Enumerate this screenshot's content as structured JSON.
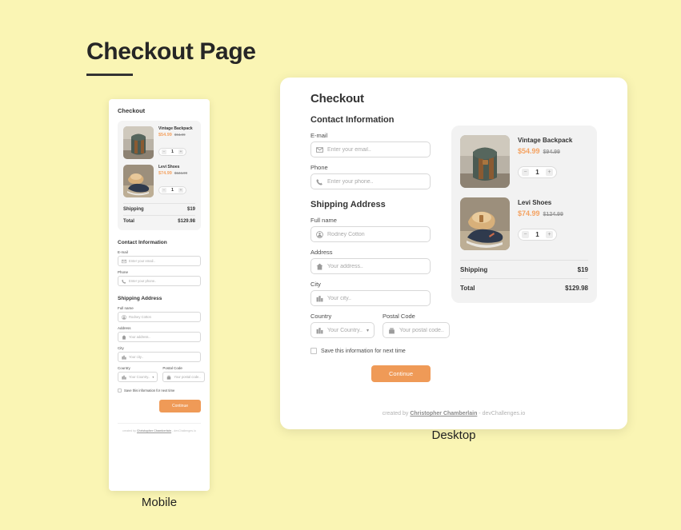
{
  "page": {
    "heading": "Checkout Page",
    "background_color": "#FAF5B4",
    "accent_color": "#EF9A57",
    "price_color": "#F4A261"
  },
  "captions": {
    "mobile": "Mobile",
    "desktop": "Desktop"
  },
  "checkout": {
    "title": "Checkout",
    "contact_section": "Contact Information",
    "shipping_section": "Shipping Address",
    "fields": {
      "email": {
        "label": "E-mail",
        "placeholder": "Enter your email..",
        "value": "",
        "icon": "envelope-icon"
      },
      "phone": {
        "label": "Phone",
        "placeholder": "Enter your phone..",
        "value": "",
        "icon": "phone-icon"
      },
      "fullname": {
        "label": "Full name",
        "placeholder": "Rodney Cotton",
        "value": "",
        "icon": "person-icon"
      },
      "address": {
        "label": "Address",
        "placeholder": "Your address..",
        "value": "",
        "icon": "home-icon"
      },
      "city": {
        "label": "City",
        "placeholder": "Your city..",
        "value": "",
        "icon": "city-icon"
      },
      "country": {
        "label": "Country",
        "placeholder": "Your Country..",
        "value": "",
        "icon": "city-icon",
        "chevron": "▾"
      },
      "postal": {
        "label": "Postal Code",
        "placeholder": "Your postal code..",
        "value": "",
        "icon": "mailbox-icon"
      }
    },
    "save_checkbox_label": "Save this information for next time",
    "save_checkbox_checked": false,
    "continue_label": "Continue"
  },
  "summary": {
    "items": [
      {
        "name": "Vintage Backpack",
        "price": "$54.99",
        "original_price": "$94.99",
        "quantity": "1",
        "decrement": "−",
        "increment": "+",
        "image": "vintage-backpack-photo"
      },
      {
        "name": "Levi Shoes",
        "price": "$74.99",
        "original_price": "$124.99",
        "quantity": "1",
        "decrement": "−",
        "increment": "+",
        "image": "levi-shoes-photo"
      }
    ],
    "totals": [
      {
        "label": "Shipping",
        "value": "$19"
      },
      {
        "label": "Total",
        "value": "$129.98"
      }
    ]
  },
  "footer": {
    "prefix": "created by ",
    "author": "Christopher Chamberlain",
    "suffix": " - devChallenges.io"
  }
}
